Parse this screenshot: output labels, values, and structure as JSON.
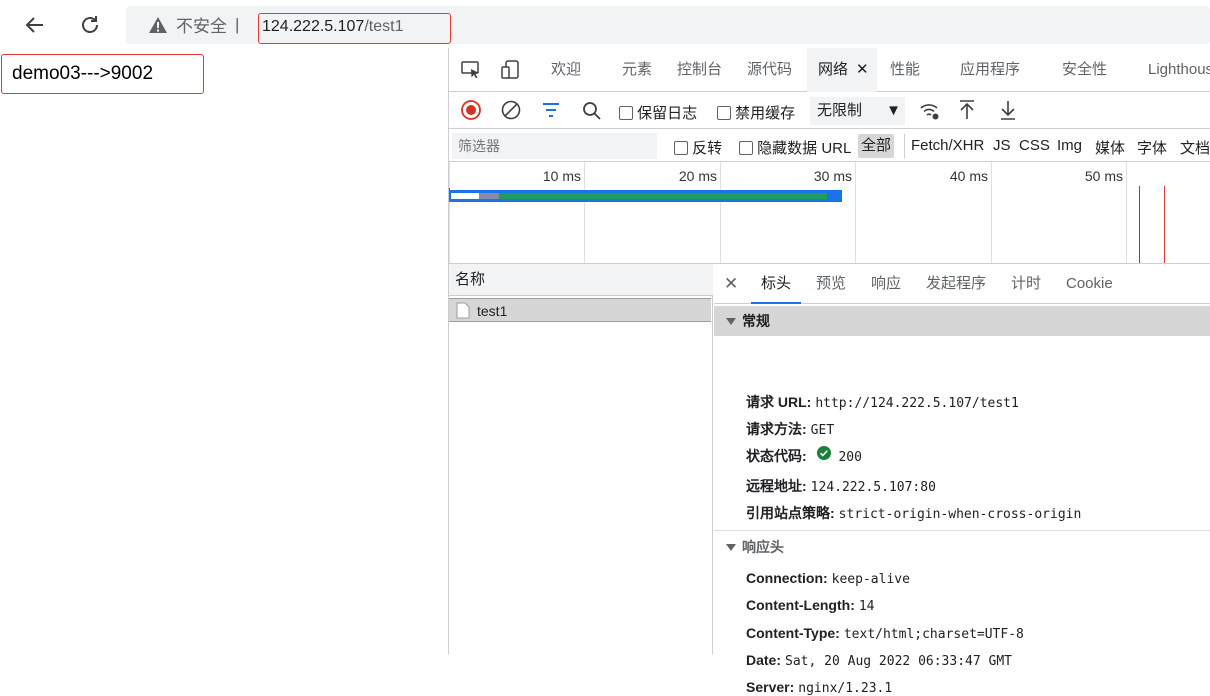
{
  "browser": {
    "back_icon": "arrow-left-icon",
    "reload_icon": "reload-icon",
    "security_label": "不安全",
    "url_host": "124.222.5.107",
    "url_path": "/test1"
  },
  "page": {
    "content": "demo03--->9002"
  },
  "devtools": {
    "tabs": [
      "欢迎",
      "元素",
      "控制台",
      "源代码",
      "网络",
      "性能",
      "应用程序",
      "安全性",
      "Lighthous"
    ],
    "active_tab": "网络",
    "toolbar": {
      "preserve_log": "保留日志",
      "disable_cache": "禁用缓存",
      "throttle": "无限制"
    },
    "filter": {
      "placeholder": "筛选器",
      "invert": "反转",
      "hide_data_url": "隐藏数据 URL",
      "types": [
        "全部",
        "Fetch/XHR",
        "JS",
        "CSS",
        "Img",
        "媒体",
        "字体",
        "文档"
      ]
    },
    "timeline": {
      "ticks": [
        "10 ms",
        "20 ms",
        "30 ms",
        "40 ms",
        "50 ms"
      ]
    },
    "requests": {
      "header": "名称",
      "rows": [
        {
          "name": "test1"
        }
      ]
    },
    "details": {
      "tabs": [
        "标头",
        "预览",
        "响应",
        "发起程序",
        "计时",
        "Cookie"
      ],
      "general": {
        "title": "常规",
        "rows": [
          {
            "key": "请求 URL:",
            "value": "http://124.222.5.107/test1"
          },
          {
            "key": "请求方法:",
            "value": "GET"
          },
          {
            "key": "状态代码:",
            "value": "200"
          },
          {
            "key": "远程地址:",
            "value": "124.222.5.107:80"
          },
          {
            "key": "引用站点策略:",
            "value": "strict-origin-when-cross-origin"
          }
        ]
      },
      "response_headers": {
        "title": "响应头",
        "rows": [
          {
            "key": "Connection:",
            "value": "keep-alive"
          },
          {
            "key": "Content-Length:",
            "value": "14"
          },
          {
            "key": "Content-Type:",
            "value": "text/html;charset=UTF-8"
          },
          {
            "key": "Date:",
            "value": "Sat, 20 Aug 2022 06:33:47 GMT"
          },
          {
            "key": "Server:",
            "value": "nginx/1.23.1"
          }
        ]
      }
    }
  }
}
